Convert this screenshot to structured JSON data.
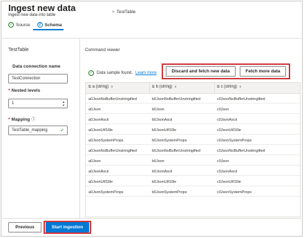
{
  "header": {
    "title": "Ingest new data",
    "subtitle": "Ingest new data into table",
    "breadcrumb": "TestTable"
  },
  "steps": [
    {
      "label": "Source",
      "icon": "check-icon",
      "status": "done"
    },
    {
      "label": "Schema",
      "icon": "2",
      "status": "active"
    }
  ],
  "left_panel": {
    "table_name": "TestTable",
    "connection_label": "Data connection name",
    "connection_value": "TestConnection",
    "nested_label": "Nested levels",
    "nested_value": "1",
    "mapping_label": "Mapping",
    "mapping_value": "TestTable_mapping"
  },
  "command_viewer": "Command viewer",
  "banner": {
    "text": "Data sample found.",
    "link": "Learn more"
  },
  "buttons": {
    "discard": "Discard and fetch new data",
    "fetch_more": "Fetch more data",
    "previous": "Previous",
    "start": "Start ingestion"
  },
  "table": {
    "columns": [
      "a (string)",
      "b (string)",
      "c (string)"
    ],
    "rows": [
      [
        "a0JsonNoBufferUnstringified",
        "b0JsonNoBufferUnstringified",
        "c0JsonNoBufferUnstringified"
      ],
      [
        "a0Json",
        "b0Json",
        "c0Json"
      ],
      [
        "a0JsonAscii",
        "b0JsonAscii",
        "c0JsonAscii"
      ],
      [
        "a0JsonUtf16le",
        "b0JsonUtf16le",
        "c0JsonUtf16le"
      ],
      [
        "a0JsonSystemProps",
        "b0JsonSystemProps",
        "c0JsonSystemProps"
      ],
      [
        "a0JsonNoBufferUnstringified",
        "b0JsonNoBufferUnstringified",
        "c0JsonNoBufferUnstringified"
      ],
      [
        "a0Json",
        "b0Json",
        "c0Json"
      ],
      [
        "a0JsonAscii",
        "b0JsonAscii",
        "c0JsonAscii"
      ],
      [
        "a0JsonUtf16le",
        "b0JsonUtf16le",
        "c0JsonUtf16le"
      ],
      [
        "a0JsonSystemProps",
        "b0JsonSystemProps",
        "c0JsonSystemProps"
      ]
    ]
  },
  "colors": {
    "accent": "#0078d4",
    "success": "#107c10",
    "highlight": "#d13438"
  }
}
